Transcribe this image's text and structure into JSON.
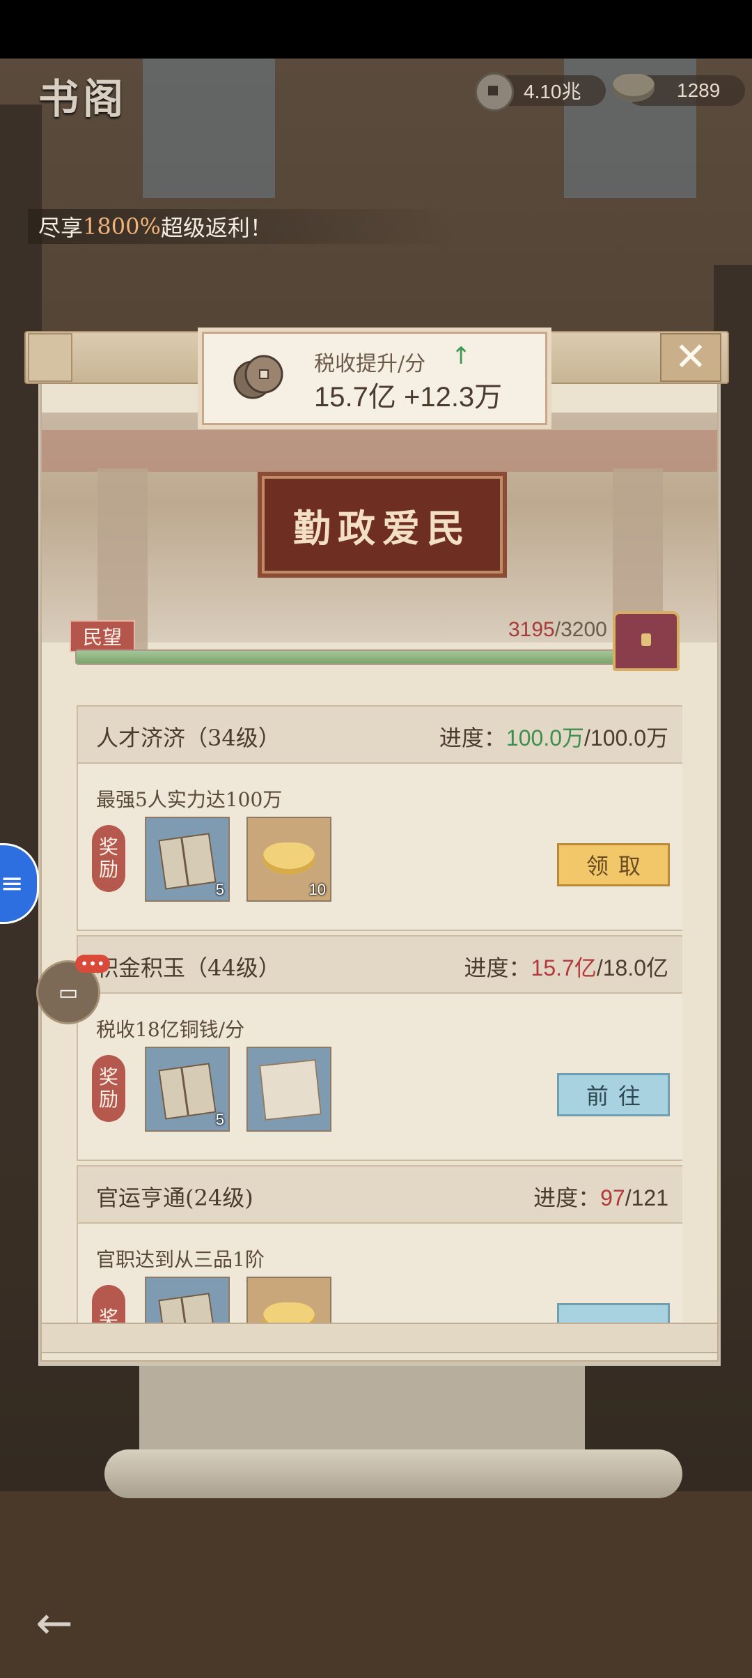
{
  "header": {
    "title": "书阁",
    "copper_value": "4.10兆",
    "ingot_value": "1289",
    "copper_icon": "copper-coin-icon",
    "ingot_icon": "gold-ingot-icon"
  },
  "banner": {
    "prefix": "尽享",
    "highlight": "1800%",
    "suffix": "超级返利！"
  },
  "tax": {
    "label": "税收提升/分",
    "arrow": "↑",
    "value": "15.7亿 +12.3万"
  },
  "plaque": {
    "text": "勤政爱民"
  },
  "reputation": {
    "label": "民望",
    "current": "3195",
    "max": "/3200",
    "progress_fraction": 0.998
  },
  "tasks": [
    {
      "name": "人才济济（34级）",
      "progress_label": "进度：",
      "progress_current": "100.0万",
      "progress_max": "/100.0万",
      "description": "最强5人实力达100万",
      "reward_label_1": "奖",
      "reward_label_2": "励",
      "item1_count": "5",
      "item2_count": "10",
      "button": "领取"
    },
    {
      "name": "积金积玉（44级）",
      "progress_label": "进度：",
      "progress_current": "15.7亿",
      "progress_max": "/18.0亿",
      "description": "税收18亿铜钱/分",
      "reward_label_1": "奖",
      "reward_label_2": "励",
      "item1_count": "5",
      "button": "前往"
    },
    {
      "name": "官运亨通(24级)",
      "progress_label": "进度：",
      "progress_current": "97",
      "progress_max": "/121",
      "description": "官职达到从三品1阶",
      "reward_label_1": "奖"
    }
  ],
  "floating": {
    "chat_badge": "•••",
    "chat_icon": "chat-bubble-icon",
    "back_icon": "back-arrow-icon"
  },
  "colors": {
    "accent_green": "#3d8f4d",
    "accent_red": "#b0393b",
    "claim_button": "#f2c76a",
    "go_button": "#a9d2e0"
  }
}
